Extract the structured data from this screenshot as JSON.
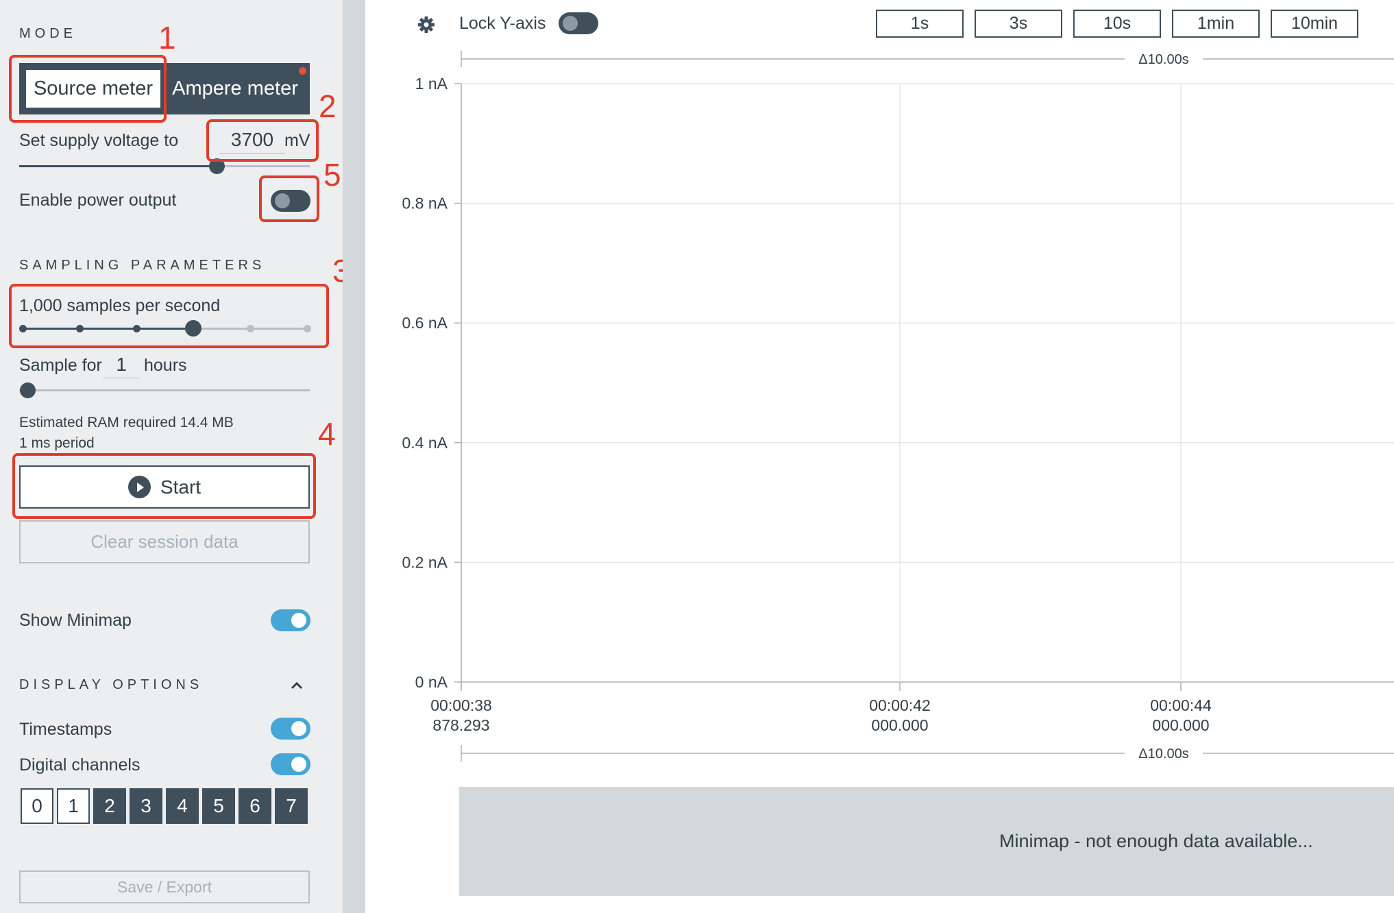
{
  "sidebar": {
    "mode": {
      "heading": "MODE",
      "source_meter_label": "Source meter",
      "ampere_meter_label": "Ampere meter",
      "selected": "Source meter"
    },
    "supply": {
      "label": "Set supply voltage to",
      "value": "3700",
      "unit": "mV",
      "slider_fraction": 0.68
    },
    "power_output": {
      "label": "Enable power output",
      "enabled": false
    },
    "sampling": {
      "heading": "SAMPLING PARAMETERS",
      "rate_label": "1,000 samples per second",
      "rate_steps": 6,
      "rate_selected_index": 3,
      "duration_prefix": "Sample for",
      "duration_value": "1",
      "duration_unit": "hours",
      "duration_slider_fraction": 0.0,
      "ram_estimate": "Estimated RAM required 14.4 MB",
      "period": "1 ms period"
    },
    "start_label": "Start",
    "clear_label": "Clear session data",
    "minimap": {
      "label": "Show Minimap",
      "enabled": true
    },
    "display_options": {
      "heading": "DISPLAY OPTIONS",
      "timestamps_label": "Timestamps",
      "timestamps_enabled": true,
      "digital_label": "Digital channels",
      "digital_enabled": true,
      "channels": [
        {
          "label": "0",
          "selected": false
        },
        {
          "label": "1",
          "selected": false
        },
        {
          "label": "2",
          "selected": true
        },
        {
          "label": "3",
          "selected": true
        },
        {
          "label": "4",
          "selected": true
        },
        {
          "label": "5",
          "selected": true
        },
        {
          "label": "6",
          "selected": true
        },
        {
          "label": "7",
          "selected": true
        }
      ]
    },
    "save_label": "Save / Export"
  },
  "annotations": [
    "1",
    "2",
    "3",
    "4",
    "5"
  ],
  "toolbar": {
    "lock_label": "Lock Y-axis",
    "lock_enabled": false,
    "windows": [
      "1s",
      "3s",
      "10s",
      "1min",
      "10min"
    ]
  },
  "chart_data": {
    "type": "line",
    "title": "",
    "xlabel": "",
    "ylabel": "",
    "y_ticks": [
      "0 nA",
      "0.2 nA",
      "0.4 nA",
      "0.6 nA",
      "0.8 nA",
      "1 nA"
    ],
    "ylim": [
      0,
      1
    ],
    "y_unit": "nA",
    "x_ticks": [
      {
        "time": "00:00:38",
        "sub": "878.293"
      },
      {
        "time": "00:00:42",
        "sub": "000.000"
      },
      {
        "time": "00:00:44",
        "sub": "000.000"
      }
    ],
    "window_top": "Δ10.00s",
    "window_bottom": "Δ10.00s",
    "series": [],
    "grid": true
  },
  "minimap_message": "Minimap - not enough data available...",
  "colors": {
    "accent": "#46a6d6",
    "dark": "#3f4f5b",
    "annotation": "#e03d2c",
    "sidebar_bg": "#eceeef"
  }
}
